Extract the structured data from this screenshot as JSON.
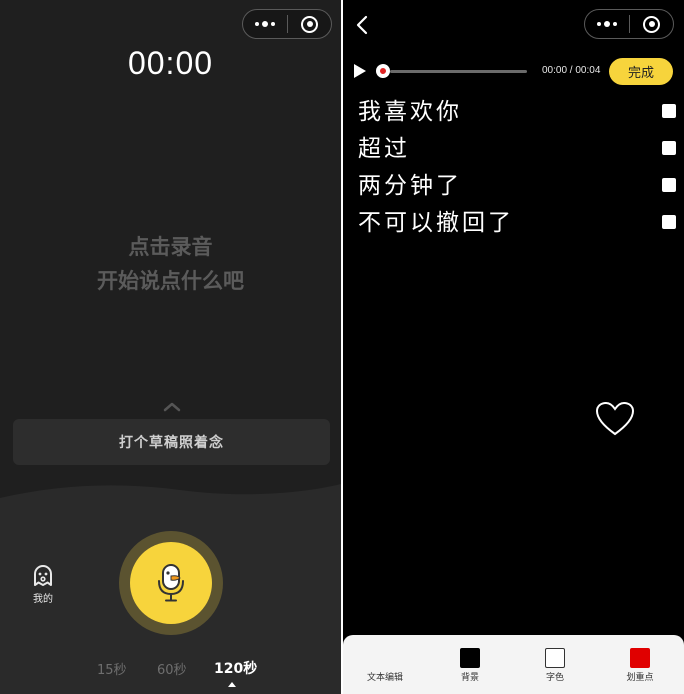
{
  "left": {
    "timer": "00:00",
    "prompt_line1": "点击录音",
    "prompt_line2": "开始说点什么吧",
    "draft_label": "打个草稿照着念",
    "mine_label": "我的",
    "durations": [
      {
        "label": "15秒",
        "selected": false
      },
      {
        "label": "60秒",
        "selected": false
      },
      {
        "label": "120秒",
        "selected": true
      }
    ]
  },
  "right": {
    "player": {
      "time": "00:00 / 00:04",
      "progress": 0.0
    },
    "done_label": "完成",
    "lines": [
      {
        "text": "我喜欢你",
        "checked": false
      },
      {
        "text": "超过",
        "checked": false
      },
      {
        "text": "两分钟了",
        "checked": false
      },
      {
        "text": "不可以撤回了",
        "checked": false
      }
    ],
    "toolbar": [
      {
        "label": "文本编辑",
        "icon": null
      },
      {
        "label": "背景",
        "icon": "swatch",
        "color": "#000000"
      },
      {
        "label": "字色",
        "icon": "swatch",
        "color": "#ffffff"
      },
      {
        "label": "划重点",
        "icon": "swatch",
        "color": "#e00000"
      }
    ]
  },
  "colors": {
    "accent_yellow": "#f7d43c",
    "left_bg": "#1f1f1f",
    "right_bg": "#000000",
    "record_red": "#e02424"
  }
}
